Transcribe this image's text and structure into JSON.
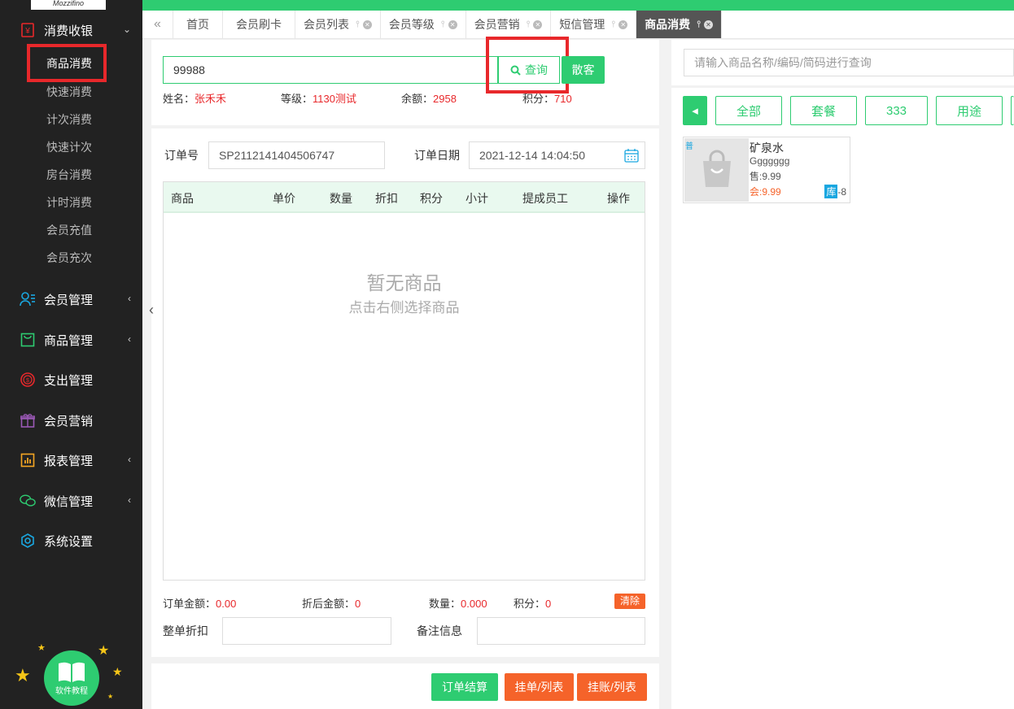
{
  "sidebar": {
    "logo_text": "Mozzifino",
    "group_consume": "消费收银",
    "sub_items": [
      "商品消费",
      "快速消费",
      "计次消费",
      "快速计次",
      "房台消费",
      "计时消费",
      "会员充值",
      "会员充次"
    ],
    "groups": [
      {
        "label": "会员管理",
        "icon": "member-icon",
        "color": "#1aa7e0"
      },
      {
        "label": "商品管理",
        "icon": "goods-icon",
        "color": "#2ecc71"
      },
      {
        "label": "支出管理",
        "icon": "expense-icon",
        "color": "#e8282b"
      },
      {
        "label": "会员营销",
        "icon": "gift-icon",
        "color": "#9b59b6"
      },
      {
        "label": "报表管理",
        "icon": "report-icon",
        "color": "#f5a623"
      },
      {
        "label": "微信管理",
        "icon": "wechat-icon",
        "color": "#2ecc71"
      },
      {
        "label": "系统设置",
        "icon": "settings-icon",
        "color": "#1aa7e0"
      }
    ],
    "help_label": "软件教程"
  },
  "tabs": [
    "首页",
    "会员刷卡",
    "会员列表",
    "会员等级",
    "会员营销",
    "短信管理",
    "商品消费"
  ],
  "search": {
    "value": "99988",
    "query_label": "查询",
    "guest_label": "散客"
  },
  "member": {
    "name_label": "姓名：",
    "name": "张禾禾",
    "level_label": "等级：",
    "level": "1130测试",
    "balance_label": "余额：",
    "balance": "2958",
    "points_label": "积分：",
    "points": "710"
  },
  "order": {
    "no_label": "订单号",
    "no": "SP2112141404506747",
    "date_label": "订单日期",
    "date": "2021-12-14 14:04:50"
  },
  "table": {
    "headers": [
      "商品",
      "单价",
      "数量",
      "折扣",
      "积分",
      "小计",
      "提成员工",
      "操作"
    ],
    "empty_title": "暂无商品",
    "empty_hint": "点击右侧选择商品"
  },
  "summary": {
    "amount_label": "订单金额：",
    "amount": "0.00",
    "discounted_label": "折后金额：",
    "discounted": "0",
    "qty_label": "数量：",
    "qty": "0.000",
    "points_label": "积分：",
    "points": "0",
    "clear_label": "清除",
    "discount_label": "整单折扣",
    "remark_label": "备注信息"
  },
  "actions": {
    "settle": "订单结算",
    "hang": "挂单/列表",
    "credit": "挂账/列表"
  },
  "right": {
    "search_placeholder": "请输入商品名称/编码/简码进行查询",
    "categories": [
      "全部",
      "套餐",
      "333",
      "用途"
    ]
  },
  "product": {
    "tag": "普",
    "name": "矿泉水",
    "code": "Ggggggg",
    "sale": "售:9.99",
    "member": "会:9.99",
    "stock_label": "库",
    "stock": "-8"
  },
  "colors": {
    "accent": "#2ecc71",
    "danger": "#e8282b",
    "orange": "#f5632a"
  }
}
